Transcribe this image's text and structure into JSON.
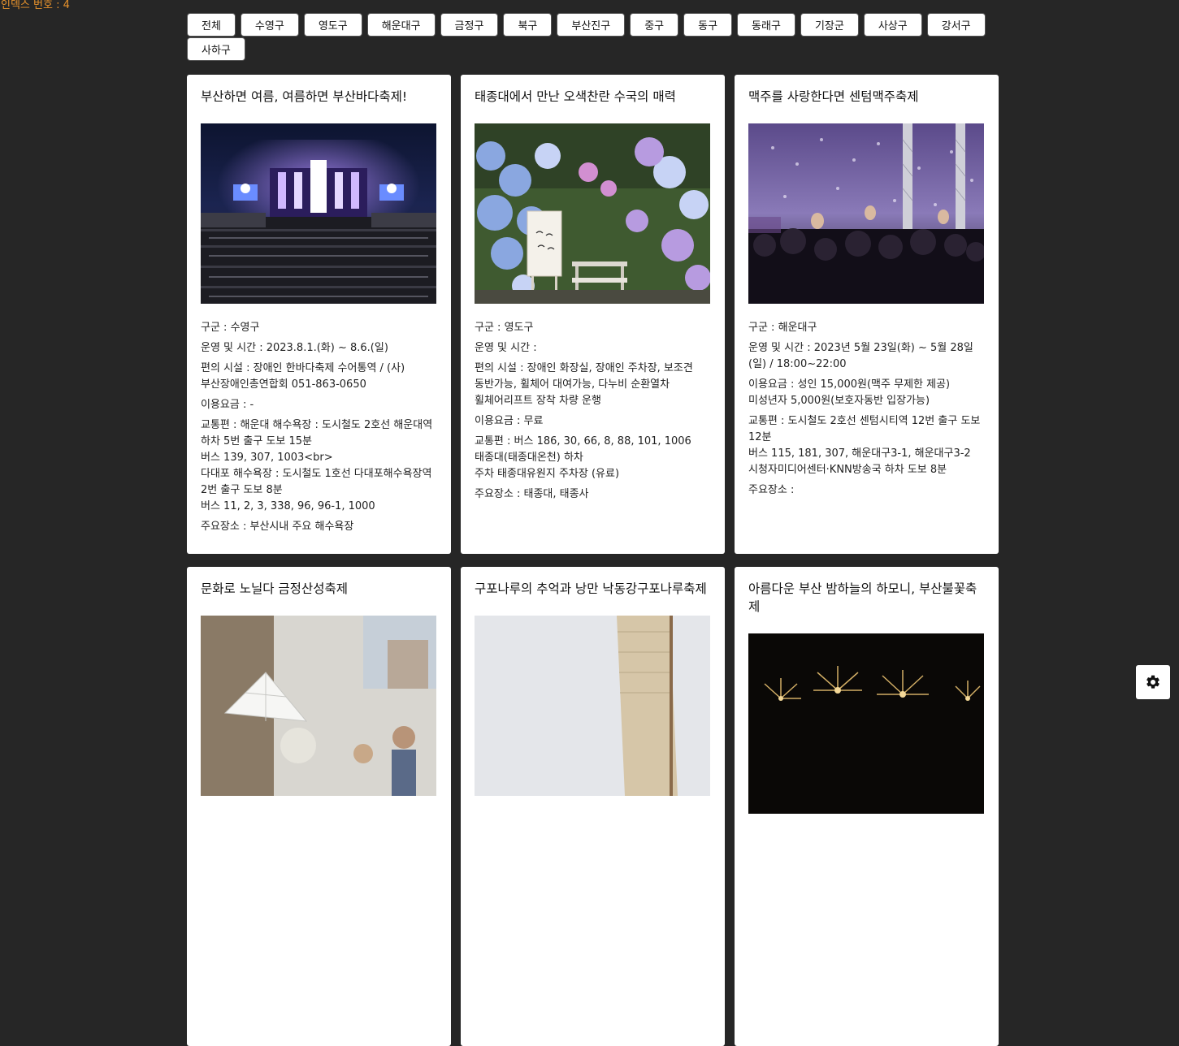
{
  "index_label": "인덱스 번호 : 4",
  "filters": [
    "전체",
    "수영구",
    "영도구",
    "해운대구",
    "금정구",
    "북구",
    "부산진구",
    "중구",
    "동구",
    "동래구",
    "기장군",
    "사상구",
    "강서구",
    "사하구"
  ],
  "cards": [
    {
      "title": "부산하면 여름, 여름하면 부산바다축제!",
      "district": "구군 : 수영구",
      "hours": "운영 및 시간 : 2023.8.1.(화) ~ 8.6.(일)",
      "facilities": "편의 시설 : 장애인 한바다축제 수어통역 / (사)부산장애인총연합회 051-863-0650",
      "fee": "이용요금 : -",
      "transport": "교통편 : 해운대 해수욕장 :   도시철도 2호선 해운대역 하차 5번 출구 도보 15분\n버스 139, 307, 1003<br>\n다대포 해수욕장 : 도시철도 1호선 다대포해수욕장역 2번 출구 도보 8분\n버스 11, 2, 3, 338, 96, 96-1, 1000",
      "places": "주요장소 : 부산시내 주요 해수욕장"
    },
    {
      "title": "태종대에서 만난 오색찬란 수국의 매력",
      "district": "구군 : 영도구",
      "hours": "운영 및 시간 :",
      "facilities": "편의 시설 : 장애인 화장실, 장애인 주차장, 보조견 동반가능, 휠체어 대여가능, 다누비 순환열차 휠체어리프트 장착 차량 운행",
      "fee": "이용요금 : 무료",
      "transport": "교통편 : 버스 186, 30, 66, 8, 88, 101, 1006 태종대(태종대온천) 하차\n주차 태종대유원지 주차장 (유료)",
      "places": "주요장소 : 태종대, 태종사"
    },
    {
      "title": "맥주를 사랑한다면 센텀맥주축제",
      "district": "구군 : 해운대구",
      "hours": "운영 및 시간 : 2023년 5월 23일(화) ~ 5월 28일(일) / 18:00~22:00",
      "fee": "이용요금 : 성인 15,000원(맥주 무제한 제공)\n미성년자 5,000원(보호자동반 입장가능)",
      "transport": "교통편 : 도시철도 2호선 센텀시티역 12번 출구 도보 12분\n버스 115, 181, 307, 해운대구3-1, 해운대구3-2 시청자미디어센터·KNN방송국 하차 도보 8분",
      "places": "주요장소 :"
    },
    {
      "title": "문화로 노닐다 금정산성축제"
    },
    {
      "title": "구포나루의 추억과 낭만 낙동강구포나루축제"
    },
    {
      "title": "아름다운 부산 밤하늘의 하모니, 부산불꽃축제"
    }
  ],
  "colors": {
    "background": "#262626",
    "index_label": "#e8932c",
    "card": "#ffffff"
  },
  "icons": {
    "settings": "gear-icon"
  }
}
